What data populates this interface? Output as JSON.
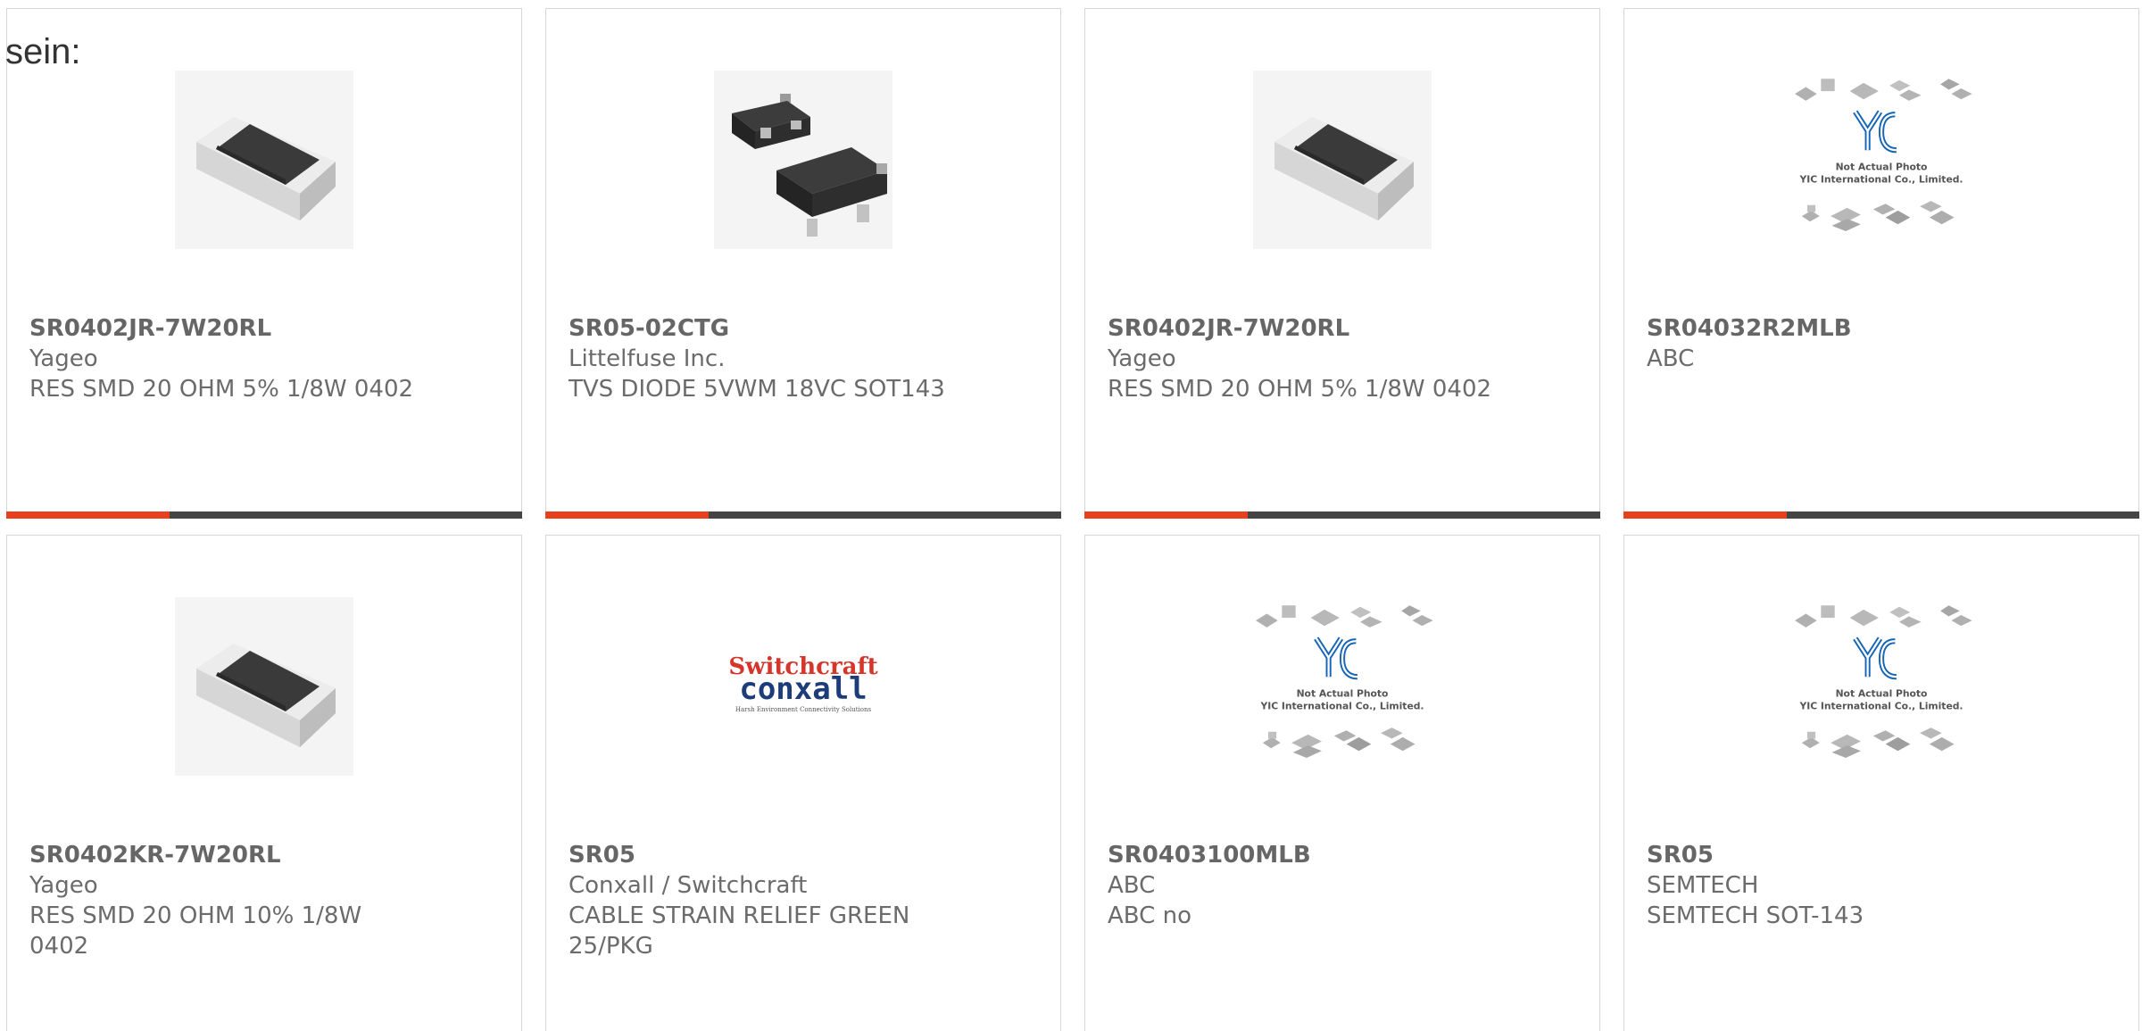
{
  "intro_text": "sein:",
  "accent_color": "#e8401c",
  "bar_color": "#444444",
  "products": [
    {
      "part": "SR0402JR-7W20RL",
      "manufacturer": "Yageo",
      "description": "RES SMD 20 OHM 5% 1/8W 0402",
      "image": "smd-resistor-image"
    },
    {
      "part": "SR05-02CTG",
      "manufacturer": "Littelfuse Inc.",
      "description": "TVS DIODE 5VWM 18VC SOT143",
      "image": "sot143-package-image"
    },
    {
      "part": "SR0402JR-7W20RL",
      "manufacturer": "Yageo",
      "description": "RES SMD 20 OHM 5% 1/8W 0402",
      "image": "smd-resistor-image"
    },
    {
      "part": "SR04032R2MLB",
      "manufacturer": "ABC",
      "description": "",
      "image": "placeholder-not-actual-photo-image"
    },
    {
      "part": "SR0402KR-7W20RL",
      "manufacturer": "Yageo",
      "description": "RES SMD 20 OHM 10% 1/8W 0402",
      "image": "smd-resistor-image"
    },
    {
      "part": "SR05",
      "manufacturer": "Conxall / Switchcraft",
      "description": "CABLE STRAIN RELIEF GREEN 25/PKG",
      "image": "switchcraft-conxall-logo-image"
    },
    {
      "part": "SR0403100MLB",
      "manufacturer": "ABC",
      "description": "ABC no",
      "image": "placeholder-not-actual-photo-image"
    },
    {
      "part": "SR05",
      "manufacturer": "SEMTECH",
      "description": "SEMTECH SOT-143",
      "image": "placeholder-not-actual-photo-image"
    }
  ],
  "placeholder": {
    "line1": "Not Actual Photo",
    "line2": "YIC International Co., Limited."
  },
  "logo": {
    "top": "Switchcraft",
    "bottom": "conxall",
    "tagline": "Harsh Environment Connectivity Solutions"
  }
}
